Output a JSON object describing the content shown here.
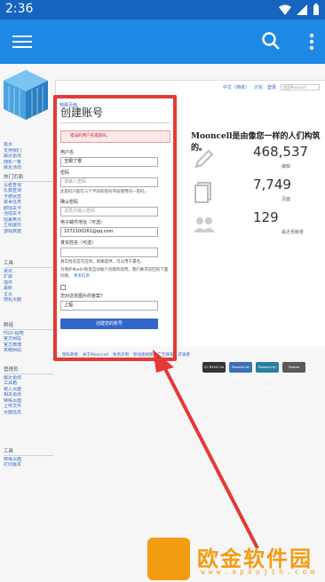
{
  "status_bar": {
    "time": "2:36"
  },
  "header": {
    "menu_icon": "menu-icon",
    "search_icon": "search-icon",
    "more_icon": "more-vert-icon"
  },
  "top_links": {
    "user": "中文（简体）",
    "talk": "讨论",
    "login": "登录",
    "search_placeholder": "搜索Mooncell"
  },
  "tab": {
    "label": "特殊页面"
  },
  "sidebar": {
    "groups": [
      {
        "head": "",
        "items": [
          "首页",
          "支持我们",
          "最近更改",
          "随机一条",
          "最近活动"
        ]
      },
      {
        "head": "热门页面",
        "items": [
          "从者查询",
          "礼装查询",
          "卡牌状态",
          "故事任务",
          "剧情关卡",
          "活动关卡",
          "招募英灵",
          "立绘展示",
          "游戏数据"
        ]
      },
      {
        "head": "工具",
        "items": [
          "资讯",
          "扩展",
          "插件",
          "最新",
          "主页",
          "随机页面"
        ]
      },
      {
        "head": "群组",
        "items": [
          "FGO-贴吧",
          "官方网站",
          "官方微博",
          "攻略网站"
        ]
      },
      {
        "head": "管理员",
        "items": [
          "最近更改",
          "工具箱",
          "链入页面",
          "相关更改",
          "特殊页面",
          "上传文件",
          "页面信息"
        ]
      },
      {
        "head": "工具",
        "items": [
          "特殊页面",
          "打印版本"
        ]
      }
    ]
  },
  "form": {
    "title": "创建账号",
    "error": "错误的用户名或密码。",
    "username_label": "用户名",
    "username_value": "玉眼了根",
    "password_label": "密码",
    "password_placeholder": "请输入密码",
    "password_help": "此密码只能在三个不同的密码字段使用同一密码。",
    "confirm_label": "确认密码",
    "confirm_placeholder": "请再次输入密码",
    "email_label": "电子邮件地址（可选）",
    "email_value": "1072100261@qq.com",
    "realname_label": "真实姓名（可选）",
    "realname_help": "真实姓名是可选项，如果提供，可以用于署名。",
    "privacy_help": "为保护本wiki免受自动账户创建的滥用，我们要求您回答下面问题。",
    "privacy_link": "更多信息",
    "captcha_label": "您对这张图片的答案？",
    "captcha_value": "上辐",
    "submit_label": "创建您的账号"
  },
  "stats": {
    "heading": "Mooncell是由像您一样的人们构筑的。",
    "items": [
      {
        "value": "468,537",
        "caption": "编辑",
        "icon": "pencil-icon"
      },
      {
        "value": "7,749",
        "caption": "页面",
        "icon": "pages-icon"
      },
      {
        "value": "129",
        "caption": "最近贡献者",
        "icon": "users-icon"
      }
    ]
  },
  "footer": {
    "links": [
      "隐私政策",
      "关于Mooncell",
      "免责声明",
      "移动版视图",
      "广告联系",
      "开发者"
    ]
  },
  "badges": [
    "CC BY-NC-SA",
    "Powered by MediaWiki",
    "Powered by Semantic MediaWiki",
    "Hosted"
  ],
  "watermark": {
    "title": "欧金软件园",
    "url": "www.apoujin.com"
  },
  "colors": {
    "appbar": "#1e88e5",
    "statusbar": "#1565c0",
    "highlight": "#e53935",
    "link": "#3366cc",
    "watermark": "#f39c12"
  }
}
